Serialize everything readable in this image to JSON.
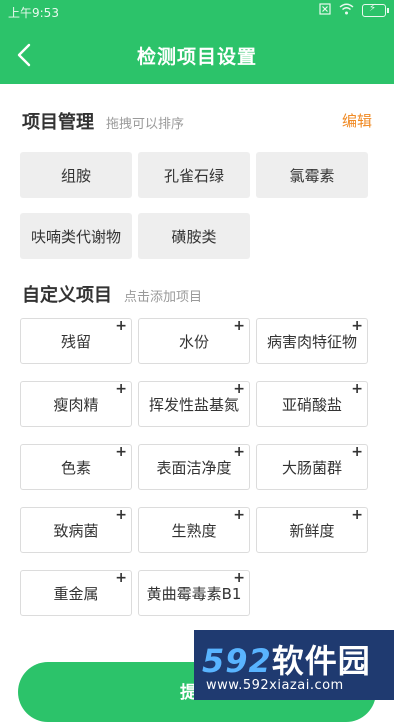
{
  "status": {
    "time": "上午9:53",
    "icons": [
      "close-box-icon",
      "wifi-icon",
      "battery-charging-icon"
    ]
  },
  "header": {
    "title": "检测项目设置",
    "back_icon": "chevron-left-icon",
    "background": "#2cc36a"
  },
  "manage": {
    "title": "项目管理",
    "hint": "拖拽可以排序",
    "edit_label": "编辑",
    "items": [
      "组胺",
      "孔雀石绿",
      "氯霉素",
      "呋喃类代谢物",
      "磺胺类"
    ]
  },
  "custom": {
    "title": "自定义项目",
    "hint": "点击添加项目",
    "add_symbol": "+",
    "items": [
      "残留",
      "水份",
      "病害肉特征物",
      "瘦肉精",
      "挥发性盐基氮",
      "亚硝酸盐",
      "色素",
      "表面洁净度",
      "大肠菌群",
      "致病菌",
      "生熟度",
      "新鲜度",
      "重金属",
      "黄曲霉毒素B1"
    ]
  },
  "submit": {
    "label": "提交"
  },
  "watermark": {
    "brand_digits": "592",
    "brand_text": "软件园",
    "url": "www.592xiazai.com"
  },
  "colors": {
    "accent": "#2cc36a",
    "edit": "#f08a24"
  }
}
